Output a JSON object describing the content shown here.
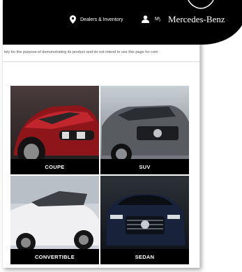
{
  "header": {
    "dealers_label": "Dealers & Inventory",
    "account_label": "My A",
    "brand": "Mercedes-Benz"
  },
  "disclaimer": "lely for the purpose of demonstrating its product and do not intend to use this page for com",
  "categories": [
    {
      "label": "COUPE",
      "color": "#9a1b1f"
    },
    {
      "label": "SUV",
      "color": "#6b6e72"
    },
    {
      "label": "CONVERTIBLE",
      "color": "#e8e8ea"
    },
    {
      "label": "SEDAN",
      "color": "#1a2540"
    }
  ],
  "icons": {
    "dealers": "map-pin-icon",
    "account": "user-icon",
    "logo": "mercedes-star-icon"
  }
}
